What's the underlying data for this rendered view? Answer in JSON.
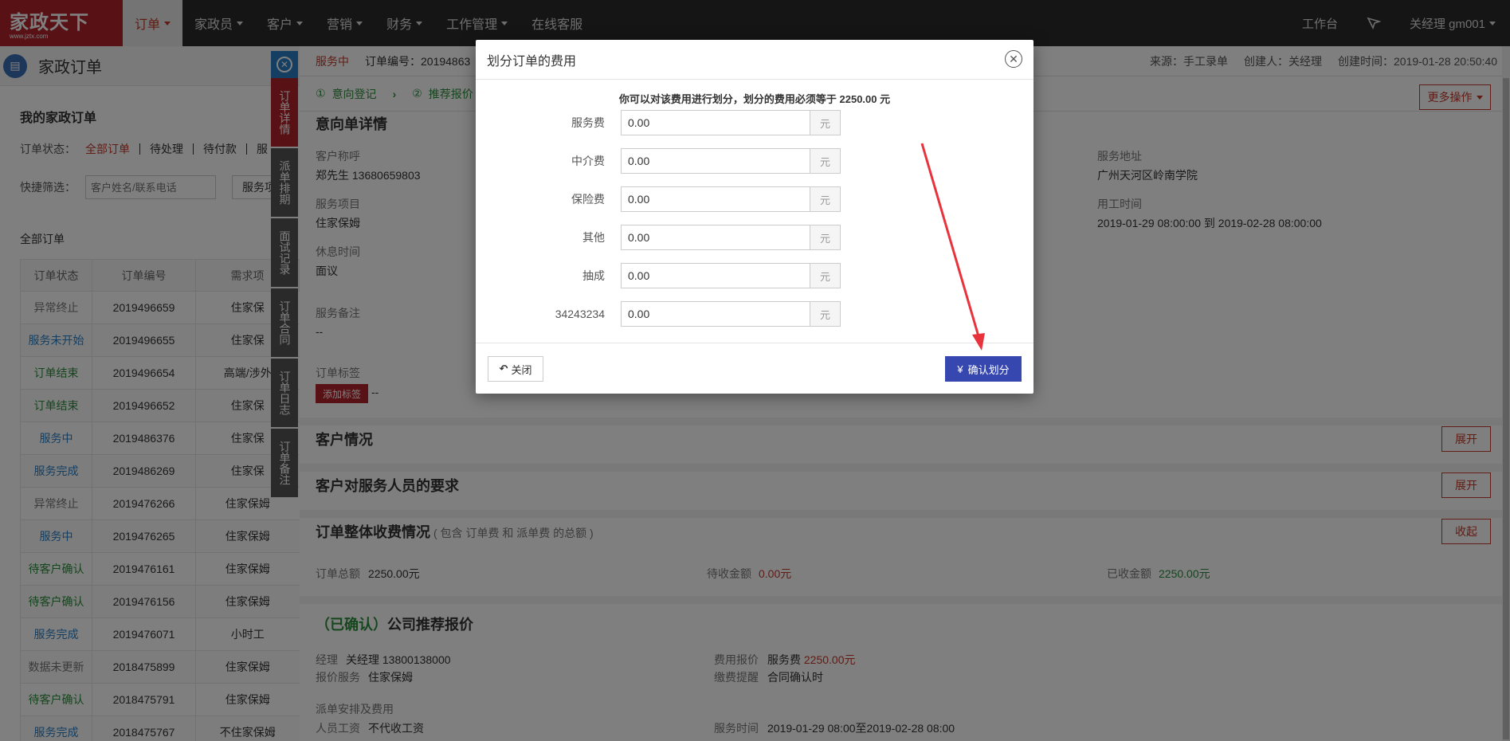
{
  "nav": {
    "logo_main": "家政天下",
    "logo_sub": "www.jztx.com",
    "items": [
      {
        "label": "订单",
        "active": true,
        "caret": true
      },
      {
        "label": "家政员",
        "active": false,
        "caret": true
      },
      {
        "label": "客户",
        "active": false,
        "caret": true
      },
      {
        "label": "营销",
        "active": false,
        "caret": true
      },
      {
        "label": "财务",
        "active": false,
        "caret": true
      },
      {
        "label": "工作管理",
        "active": false,
        "caret": true
      },
      {
        "label": "在线客服",
        "active": false,
        "caret": false
      }
    ],
    "workbench": "工作台",
    "user": "关经理 gm001"
  },
  "left": {
    "title": "家政订单",
    "subtitle": "我的家政订单",
    "status_label": "订单状态：",
    "status_tabs": [
      "全部订单",
      "待处理",
      "待付款",
      "服"
    ],
    "filter_label": "快捷筛选：",
    "filter_placeholder": "客户姓名/联系电话",
    "filter_button": "服务项",
    "all_label": "全部订单",
    "columns": [
      "订单状态",
      "订单编号",
      "需求项"
    ],
    "rows": [
      {
        "status": "异常终止",
        "color": "#777777",
        "no": "2019496659",
        "item": "住家保"
      },
      {
        "status": "服务未开始",
        "color": "#2b7fc4",
        "no": "2019496655",
        "item": "住家保"
      },
      {
        "status": "订单结束",
        "color": "#2a8c3a",
        "no": "2019496654",
        "item": "高端/涉外"
      },
      {
        "status": "订单结束",
        "color": "#2a8c3a",
        "no": "2019496652",
        "item": "住家保"
      },
      {
        "status": "服务中",
        "color": "#2b7fc4",
        "no": "2019486376",
        "item": "住家保"
      },
      {
        "status": "服务完成",
        "color": "#2b7fc4",
        "no": "2019486269",
        "item": "住家保"
      },
      {
        "status": "异常终止",
        "color": "#777777",
        "no": "2019476266",
        "item": "住家保姆"
      },
      {
        "status": "服务中",
        "color": "#2b7fc4",
        "no": "2019476265",
        "item": "住家保姆"
      },
      {
        "status": "待客户确认",
        "color": "#2a8c3a",
        "no": "2019476161",
        "item": "住家保姆"
      },
      {
        "status": "待客户确认",
        "color": "#2a8c3a",
        "no": "2019476156",
        "item": "住家保姆"
      },
      {
        "status": "服务完成",
        "color": "#2b7fc4",
        "no": "2019476071",
        "item": "小时工"
      },
      {
        "status": "数据未更新",
        "color": "#777777",
        "no": "2018475899",
        "item": "住家保姆"
      },
      {
        "status": "待客户确认",
        "color": "#2a8c3a",
        "no": "2018475791",
        "item": "住家保姆"
      },
      {
        "status": "服务完成",
        "color": "#2b7fc4",
        "no": "2018475767",
        "item": "不住家保姆"
      }
    ]
  },
  "sidetabs": [
    "订单详情",
    "派单排期",
    "面试记录",
    "订单合同",
    "订单日志",
    "订单备注"
  ],
  "main": {
    "status": "服务中",
    "order_no": "订单编号：20194863",
    "source": "来源：手工录单",
    "creator": "创建人：关经理",
    "created": "创建时间：2019-01-28 20:50:40",
    "step1": "意向登记",
    "step2": "推荐报价",
    "more_ops": "更多操作",
    "intent_title": "意向单详情",
    "customer_label": "客户称呼",
    "customer_value": "郑先生 13680659803",
    "address_label": "服务地址",
    "address_value": "广州天河区岭南学院",
    "service_label": "服务项目",
    "service_value": "住家保姆",
    "worktime_label": "用工时间",
    "worktime_value": "2019-01-29 08:00:00 到 2019-02-28 08:00:00",
    "rest_label": "休息时间",
    "rest_value": "面议",
    "remark_label": "服务备注",
    "remark_value": "--",
    "tag_label": "订单标签",
    "tag_button": "添加标签",
    "tag_value": "--",
    "cust_title": "客户情况",
    "req_title": "客户对服务人员的要求",
    "fee_title": "订单整体收费情况",
    "fee_note": "( 包含 订单费 和 派单费 的总额 )",
    "expand": "展开",
    "collapse": "收起",
    "total_label": "订单总额",
    "total_value": "2250.00元",
    "pending_label": "待收金额",
    "pending_value": "0.00元",
    "received_label": "已收金额",
    "received_value": "2250.00元",
    "quote_confirmed": "（已确认）",
    "quote_title": "公司推荐报价",
    "manager_label": "经理",
    "manager_value": "关经理 13800138000",
    "quote_fee_label": "费用报价",
    "quote_fee_name": "服务费",
    "quote_fee_value": "2250.00元",
    "quote_service_label": "报价服务",
    "quote_service_value": "住家保姆",
    "pay_remind_label": "缴费提醒",
    "pay_remind_value": "合同确认时",
    "dispatch_label": "派单安排及费用",
    "salary_label": "人员工资",
    "salary_value": "不代收工资",
    "svc_time_label": "服务时间",
    "svc_time_value": "2019-01-29 08:00至2019-02-28 08:00"
  },
  "modal": {
    "title": "划分订单的费用",
    "hint": "你可以对该费用进行划分，划分的费用必须等于 2250.00 元",
    "unit": "元",
    "fields": [
      {
        "label": "服务费",
        "value": "0.00"
      },
      {
        "label": "中介费",
        "value": "0.00"
      },
      {
        "label": "保险费",
        "value": "0.00"
      },
      {
        "label": "其他",
        "value": "0.00"
      },
      {
        "label": "抽成",
        "value": "0.00"
      },
      {
        "label": "34243234",
        "value": "0.00"
      }
    ],
    "close_button": "关闭",
    "confirm_button": "确认划分"
  },
  "colors": {
    "brand": "#b0232b",
    "confirm": "#3647b0",
    "arrow": "#e8323c"
  }
}
